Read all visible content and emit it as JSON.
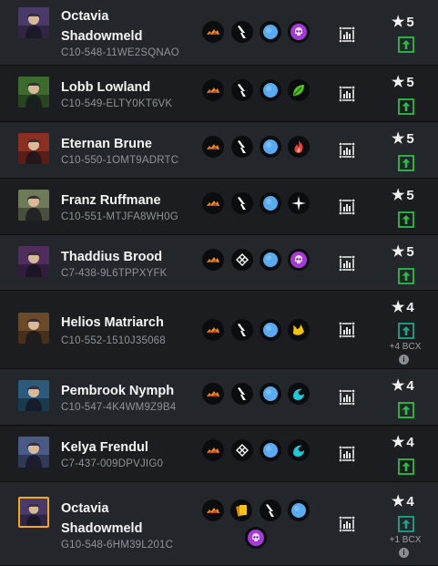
{
  "accent_colors": {
    "upgrade_green": "#2bbd4a",
    "upgrade_teal": "#1fa489",
    "star": "#f2f2f2",
    "gold_border": "#f0a81c"
  },
  "cards": [
    {
      "name_lines": [
        "Octavia",
        "Shadowmeld"
      ],
      "code": "C10-548-11WE2SQNAO",
      "stars": "5",
      "upgrade": "green",
      "bcx": "",
      "element_icon": "death-skull-icon",
      "portrait_color": "#4a3a6a"
    },
    {
      "name_lines": [
        "Lobb Lowland"
      ],
      "code": "C10-549-ELTY0KT6VK",
      "stars": "5",
      "upgrade": "green",
      "bcx": "",
      "element_icon": "earth-leaf-icon",
      "portrait_color": "#3d6b2e"
    },
    {
      "name_lines": [
        "Eternan Brune"
      ],
      "code": "C10-550-1OMT9ADRTC",
      "stars": "5",
      "upgrade": "green",
      "bcx": "",
      "element_icon": "fire-flame-icon",
      "portrait_color": "#8a2f22"
    },
    {
      "name_lines": [
        "Franz Ruffmane"
      ],
      "code": "C10-551-MTJFA8WH0G",
      "stars": "5",
      "upgrade": "green",
      "bcx": "",
      "element_icon": "life-star-icon",
      "portrait_color": "#6f7a5a"
    },
    {
      "name_lines": [
        "Thaddius Brood"
      ],
      "code": "C7-438-9L6TPPXYFK",
      "stars": "5",
      "upgrade": "green",
      "bcx": "",
      "element_icon": "death-skull-icon",
      "portrait_color": "#4f2d5c"
    },
    {
      "name_lines": [
        "Helios Matriarch"
      ],
      "code": "C10-552-1510J35068",
      "stars": "4",
      "upgrade": "teal",
      "bcx": "+4 BCX",
      "element_icon": "dragon-claw-icon",
      "portrait_color": "#6b4a2a"
    },
    {
      "name_lines": [
        "Pembrook Nymph"
      ],
      "code": "C10-547-4K4WM9Z9B4",
      "stars": "4",
      "upgrade": "green",
      "bcx": "",
      "element_icon": "water-wave-icon",
      "portrait_color": "#2c5a7a"
    },
    {
      "name_lines": [
        "Kelya Frendul"
      ],
      "code": "C7-437-009DPVJIG0",
      "stars": "4",
      "upgrade": "green",
      "bcx": "",
      "element_icon": "water-wave-icon",
      "portrait_color": "#4a5a86"
    },
    {
      "name_lines": [
        "Octavia",
        "Shadowmeld"
      ],
      "code": "G10-548-6HM39L201C",
      "stars": "4",
      "upgrade": "teal",
      "bcx": "+1 BCX",
      "element_icon": "death-skull-icon",
      "portrait_color": "#4a3a6a"
    }
  ]
}
